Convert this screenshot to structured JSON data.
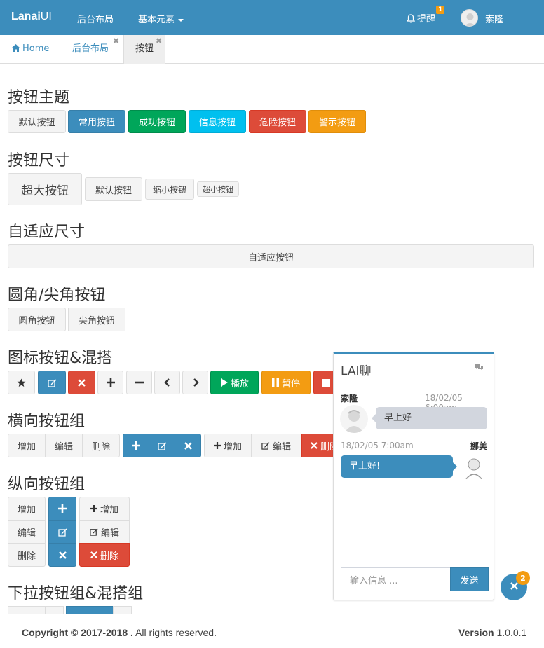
{
  "navbar": {
    "brand_bold": "Lanai",
    "brand_light": "UI",
    "links": [
      "后台布局",
      "基本元素"
    ],
    "remind_label": "提醒",
    "remind_count": "1",
    "user_name": "索隆",
    "bg_color": "#3c8dbc"
  },
  "tabs": [
    {
      "label": "Home",
      "icon": "home-icon"
    },
    {
      "label": "后台布局",
      "closable": true
    },
    {
      "label": "按钮",
      "closable": true,
      "active": true
    }
  ],
  "sections": {
    "themes": {
      "title": "按钮主题",
      "buttons": [
        "默认按钮",
        "常用按钮",
        "成功按钮",
        "信息按钮",
        "危险按钮",
        "警示按钮"
      ]
    },
    "sizes": {
      "title": "按钮尺寸",
      "buttons": [
        "超大按钮",
        "默认按钮",
        "缩小按钮",
        "超小按钮"
      ]
    },
    "block": {
      "title": "自适应尺寸",
      "button": "自适应按钮"
    },
    "radius": {
      "title": "圆角/尖角按钮",
      "buttons": [
        "圆角按钮",
        "尖角按钮"
      ]
    },
    "icons": {
      "title": "图标按钮&混搭",
      "play": "播放",
      "pause": "暂停"
    },
    "hgroup": {
      "title": "横向按钮组",
      "plain": [
        "增加",
        "编辑",
        "删除"
      ],
      "mixed": [
        "增加",
        "编辑",
        "删除"
      ]
    },
    "vgroup": {
      "title": "纵向按钮组",
      "plain": [
        "增加",
        "编辑",
        "删除"
      ],
      "mixed": [
        "增加",
        "编辑",
        "删除"
      ]
    },
    "dropdown": {
      "title": "下拉按钮组&混搭组"
    }
  },
  "chat": {
    "title": "LAI聊",
    "messages": [
      {
        "name": "索隆",
        "time": "18/02/05 6:00am",
        "text": "早上好"
      },
      {
        "name": "娜美",
        "time": "18/02/05 7:00am",
        "text": "早上好!"
      }
    ],
    "input_placeholder": "输入信息 ...",
    "send_label": "发送"
  },
  "fab_badge": "2",
  "footer": {
    "copyright_bold": "Copyright © 2017-2018 .",
    "copyright_rest": " All rights reserved.",
    "version_label": "Version",
    "version_number": "1.0.0.1"
  },
  "colors": {
    "primary": "#3c8dbc",
    "success": "#00a65a",
    "info": "#00c0ef",
    "danger": "#dd4b39",
    "warning": "#f39c12"
  }
}
